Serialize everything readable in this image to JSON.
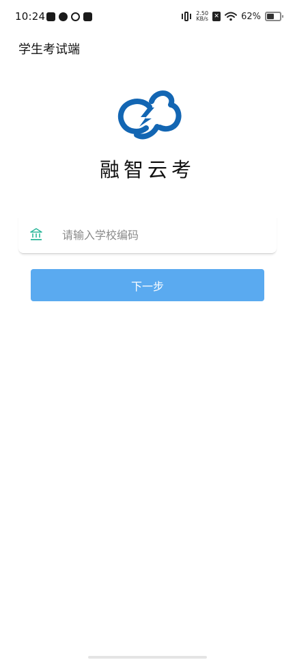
{
  "status_bar": {
    "time": "10:24",
    "net_speed_value": "2.50",
    "net_speed_unit": "KB/s",
    "sim_label": "✕",
    "battery_percent": "62%",
    "battery_level": 0.62
  },
  "app": {
    "title": "学生考试端"
  },
  "brand": {
    "name": "融智云考",
    "logo_color": "#1366b3"
  },
  "school_field": {
    "icon": "bank-icon",
    "icon_color": "#2bb79a",
    "value": "",
    "placeholder": "请输入学校编码"
  },
  "next_button": {
    "label": "下一步",
    "color": "#5aaaf0"
  }
}
